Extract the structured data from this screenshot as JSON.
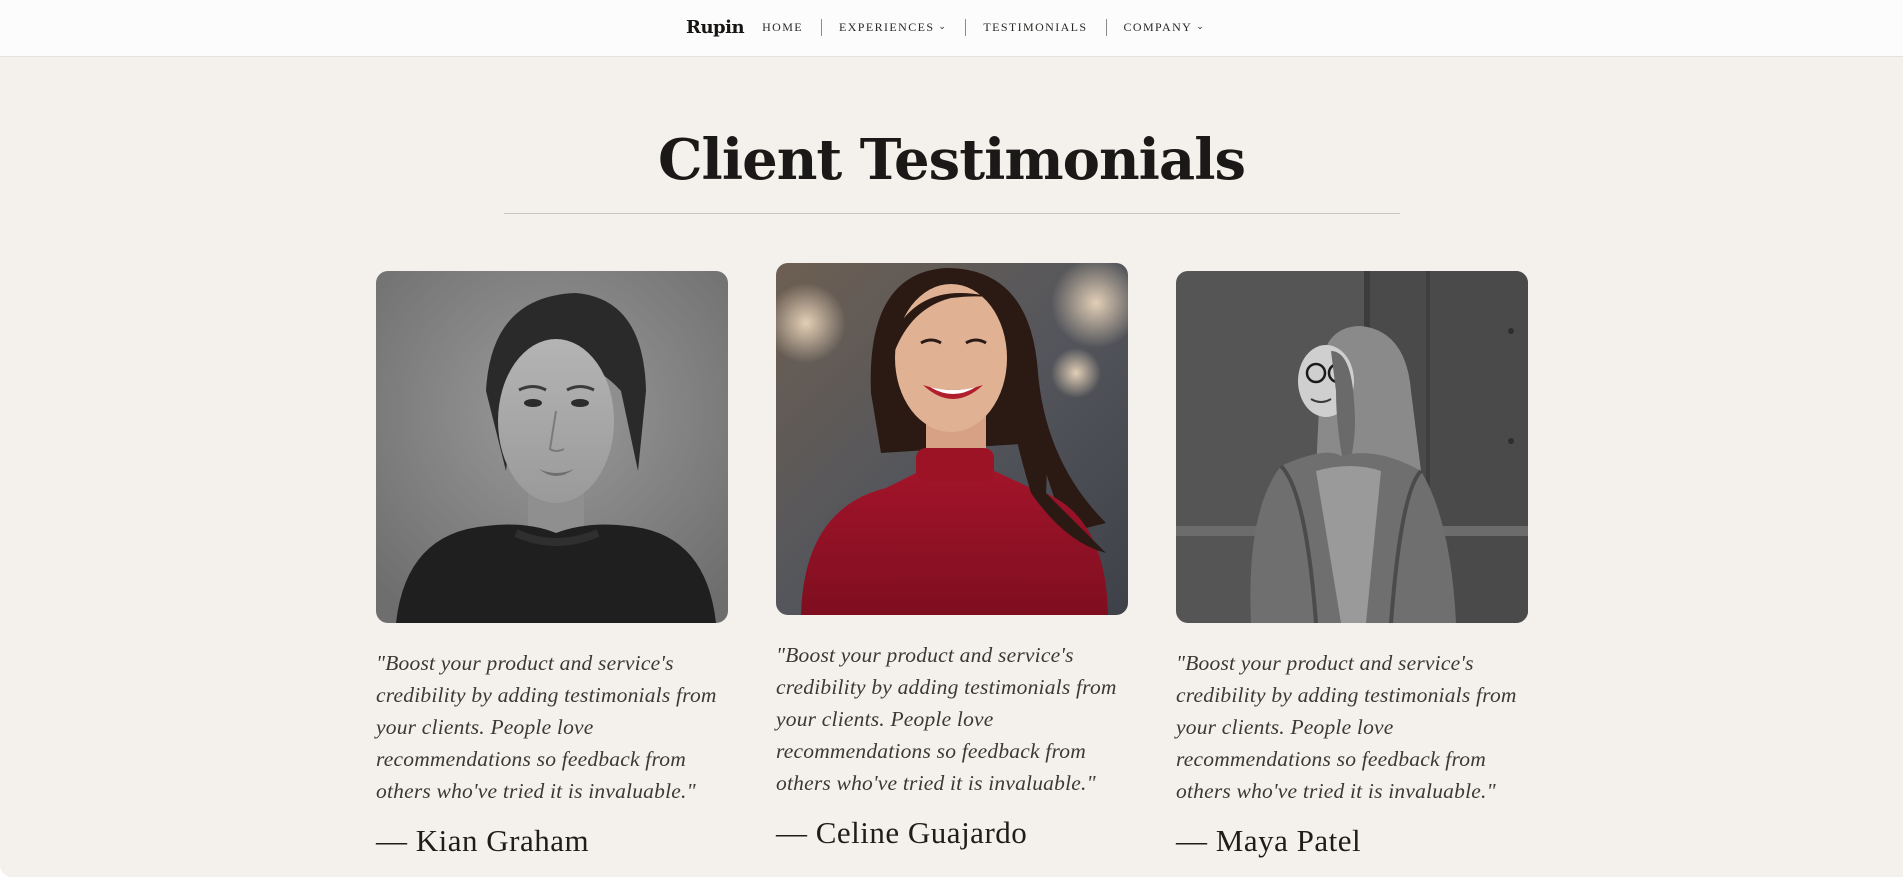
{
  "nav": {
    "brand": "Rupin",
    "items": [
      {
        "label": "HOME",
        "has_dropdown": false
      },
      {
        "label": "EXPERIENCES",
        "has_dropdown": true
      },
      {
        "label": "TESTIMONIALS",
        "has_dropdown": false
      },
      {
        "label": "COMPANY",
        "has_dropdown": true
      }
    ],
    "dropdown_icon": "chevron-down-icon"
  },
  "page": {
    "title": "Client Testimonials"
  },
  "testimonials": [
    {
      "quote": "\"Boost your product and service's credibility by adding testimonials from your clients. People love recommendations so feedback from others who've tried it is invaluable.\"",
      "author": "— Kian Graham"
    },
    {
      "quote": "\"Boost your product and service's credibility by adding testimonials from your clients. People love recommendations so feedback from others who've tried it is invaluable.\"",
      "author": "— Celine Guajardo"
    },
    {
      "quote": "\"Boost your product and service's credibility by adding testimonials from your clients. People love recommendations so feedback from others who've tried it is invaluable.\"",
      "author": "— Maya Patel"
    }
  ],
  "colors": {
    "background": "#f4f1ec",
    "navbar": "#fcfcfc",
    "text": "#1c1b19",
    "accent_red": "#a3142a"
  }
}
